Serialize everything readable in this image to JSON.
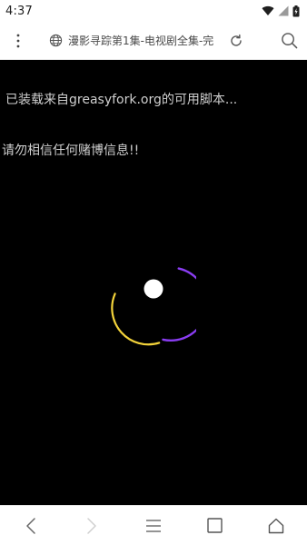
{
  "status_bar": {
    "time": "4:37",
    "icons": [
      "wifi-icon",
      "signal-icon",
      "battery-charging-icon"
    ]
  },
  "toolbar": {
    "menu_icon": "more-vertical-icon",
    "site_icon": "globe-icon",
    "page_title": "漫影寻踪第1集-电视剧全集-完",
    "reload_icon": "reload-icon",
    "search_icon": "search-icon"
  },
  "content": {
    "message_1": "已装载来自greasyfork.org的可用脚本...",
    "message_2": "请勿相信任何赌博信息!!",
    "loader": {
      "arc_colors": [
        "#f2d23a",
        "#8a3df2"
      ],
      "dot_color": "#ffffff"
    }
  },
  "bottom_nav": {
    "items": [
      "back-icon",
      "forward-icon",
      "menu-lines-icon",
      "tabs-square-icon",
      "home-icon"
    ]
  },
  "colors": {
    "background": "#000000",
    "bars": "#ffffff",
    "text_muted": "#cfcfcf"
  }
}
